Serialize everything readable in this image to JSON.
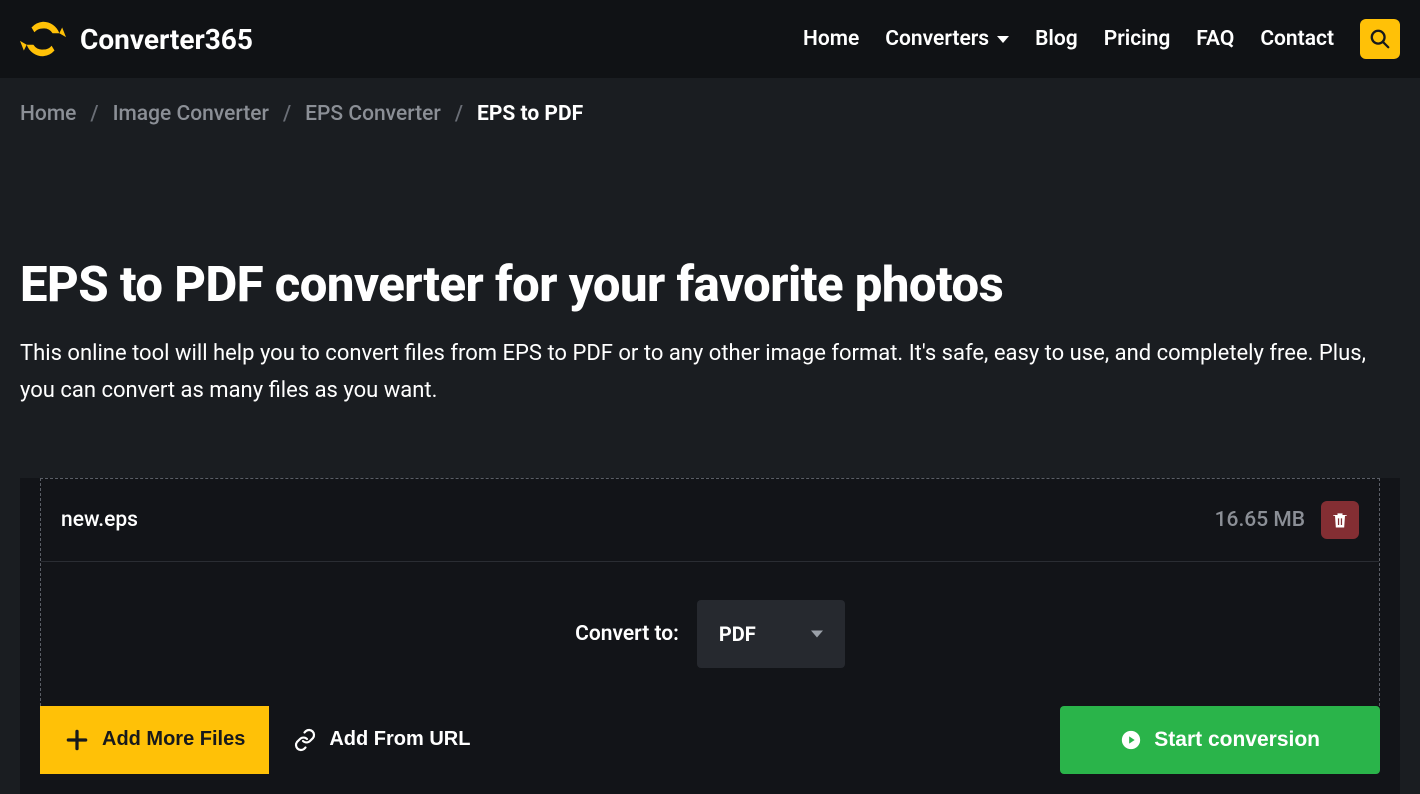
{
  "brand": "Converter365",
  "nav": {
    "home": "Home",
    "converters": "Converters",
    "blog": "Blog",
    "pricing": "Pricing",
    "faq": "FAQ",
    "contact": "Contact"
  },
  "breadcrumb": {
    "home": "Home",
    "image": "Image Converter",
    "eps": "EPS Converter",
    "current": "EPS to PDF"
  },
  "hero": {
    "title": "EPS to PDF converter for your favorite photos",
    "subtitle": "This online tool will help you to convert files from EPS to PDF or to any other image format. It's safe, easy to use, and completely free. Plus, you can convert as many files as you want."
  },
  "file": {
    "name": "new.eps",
    "size": "16.65 MB"
  },
  "convert": {
    "label": "Convert to:",
    "selected": "PDF"
  },
  "actions": {
    "add_more": "Add More Files",
    "add_url": "Add From URL",
    "start": "Start conversion"
  }
}
